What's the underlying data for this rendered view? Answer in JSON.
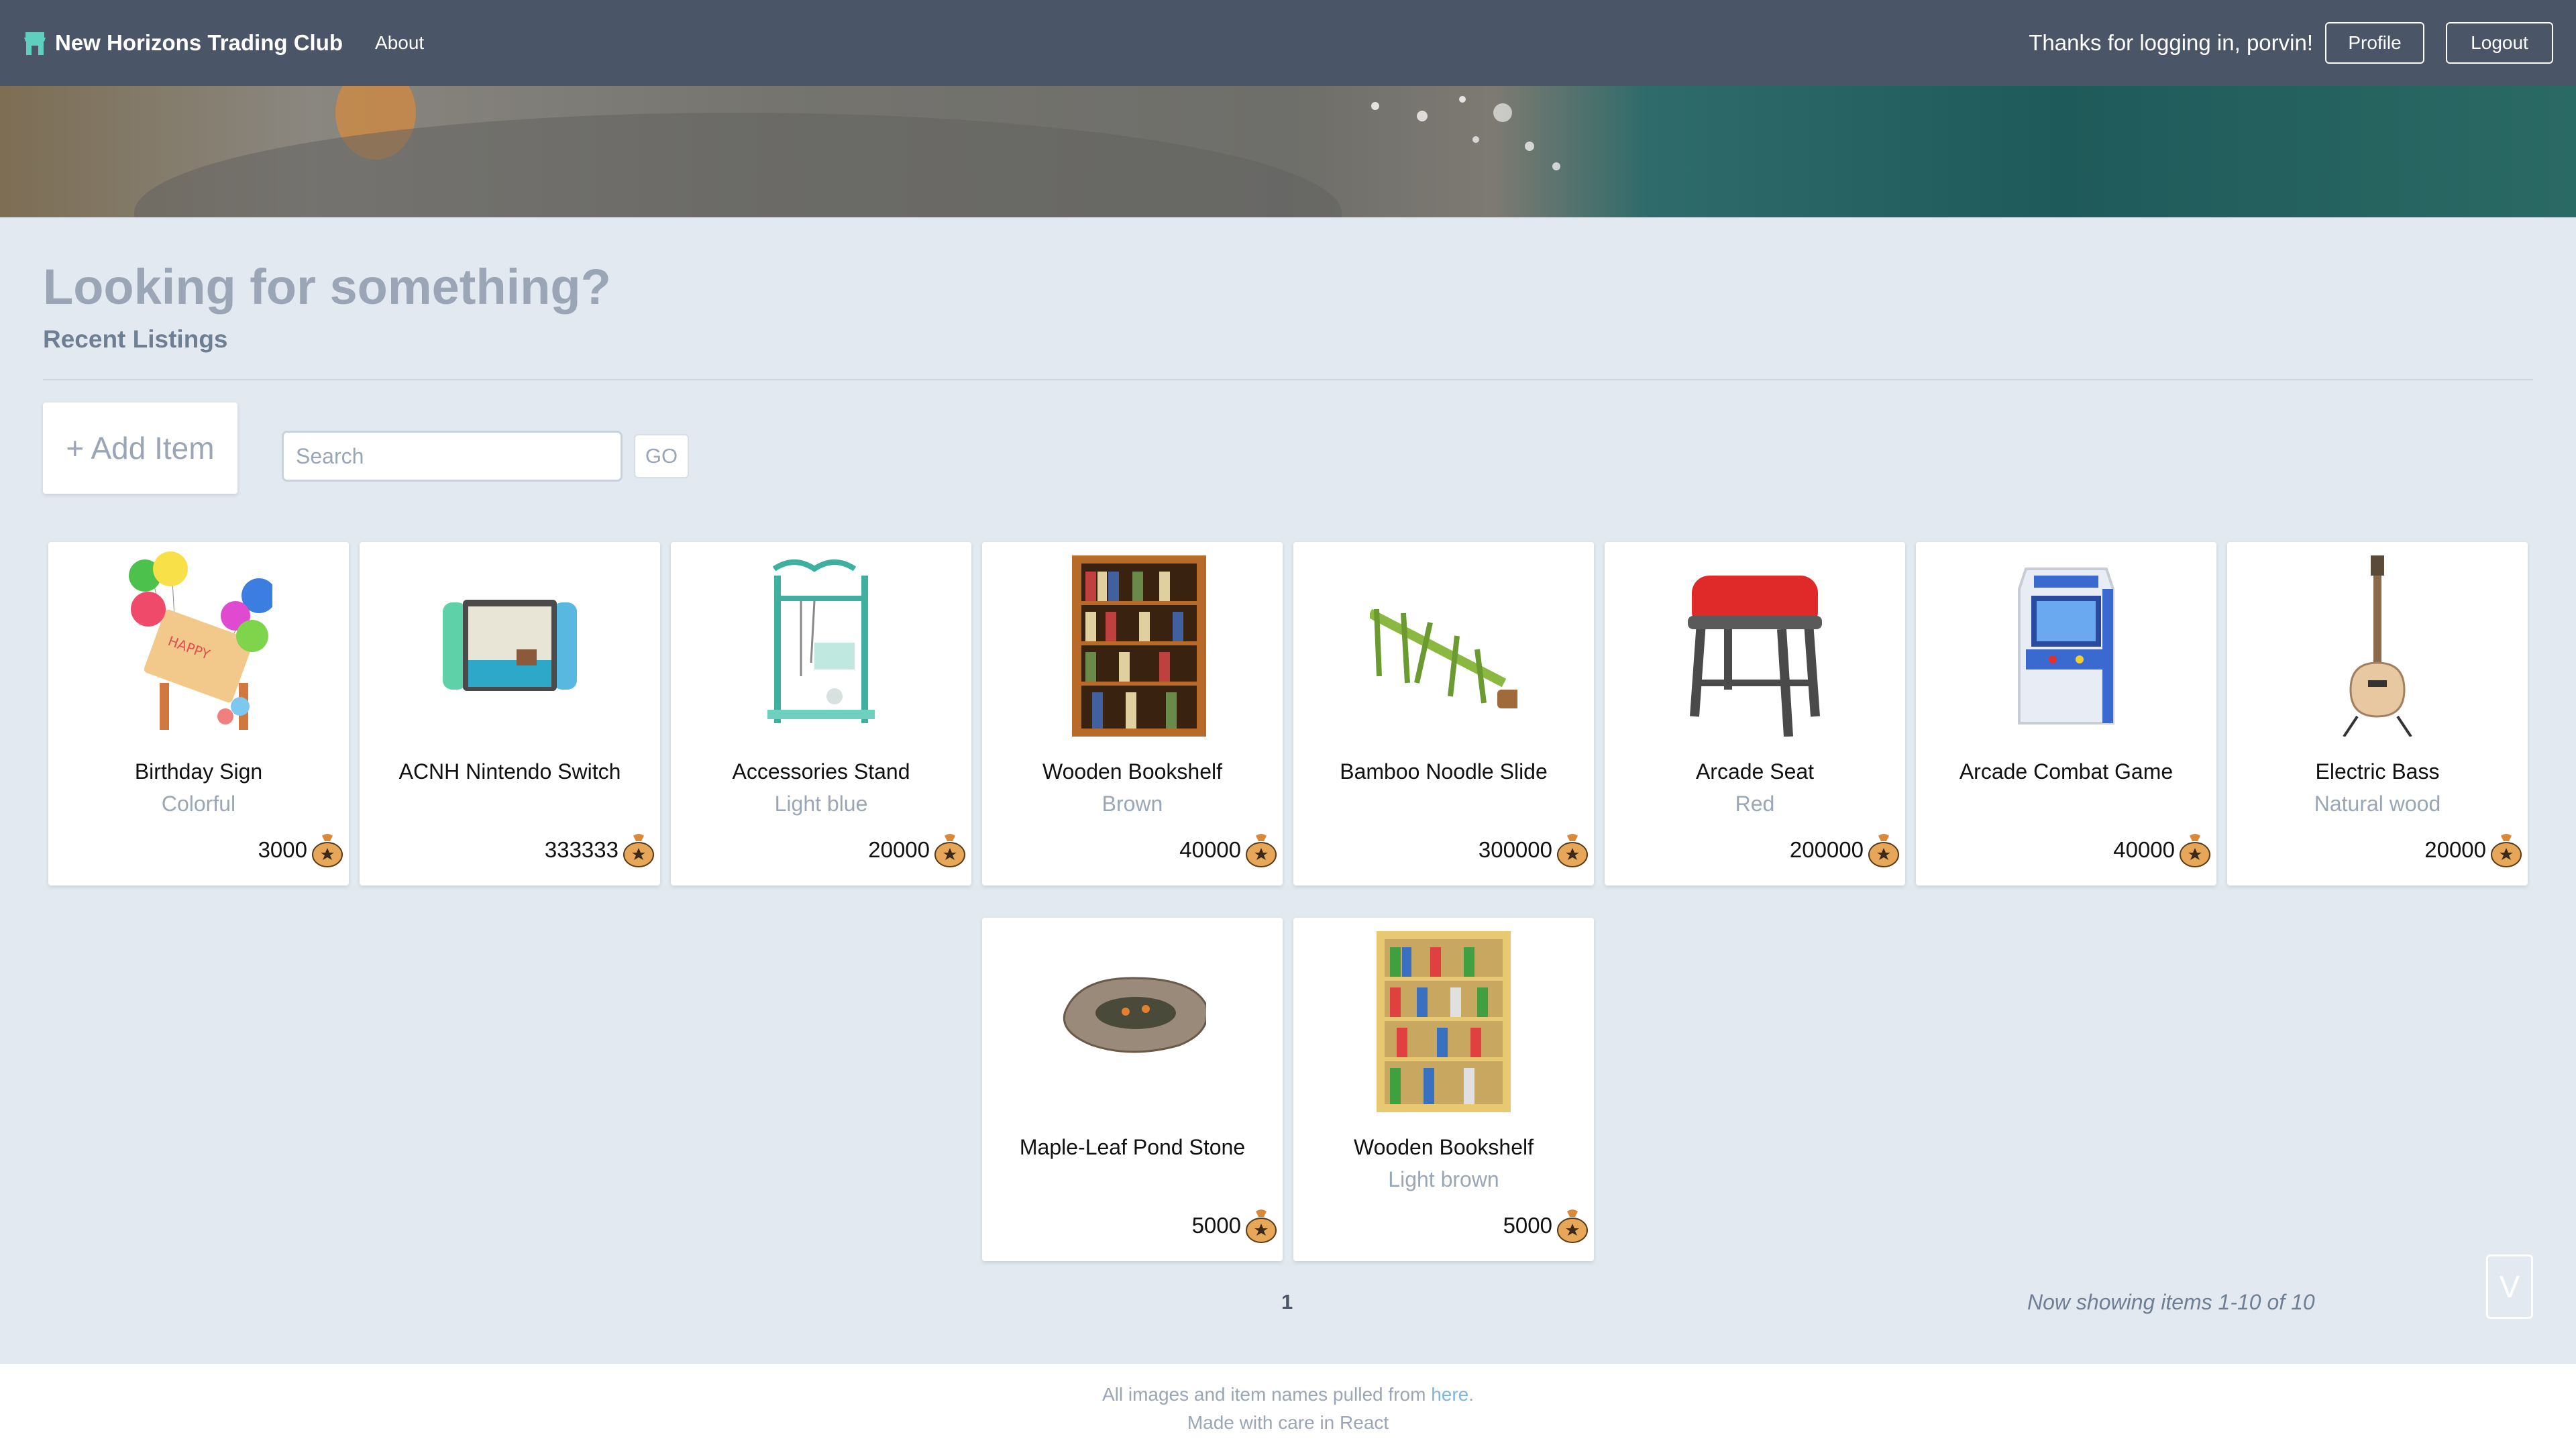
{
  "navbar": {
    "brand": "New Horizons Trading Club",
    "about": "About",
    "welcome": "Thanks for logging in, porvin!",
    "profile": "Profile",
    "logout": "Logout"
  },
  "main": {
    "title": "Looking for something?",
    "subtitle": "Recent Listings",
    "add_item": "+ Add Item",
    "search_placeholder": "Search",
    "go": "GO"
  },
  "items": [
    {
      "name": "Birthday Sign",
      "variant": "Colorful",
      "price": "3000"
    },
    {
      "name": "ACNH Nintendo Switch",
      "variant": "",
      "price": "333333"
    },
    {
      "name": "Accessories Stand",
      "variant": "Light blue",
      "price": "20000"
    },
    {
      "name": "Wooden Bookshelf",
      "variant": "Brown",
      "price": "40000"
    },
    {
      "name": "Bamboo Noodle Slide",
      "variant": "",
      "price": "300000"
    },
    {
      "name": "Arcade Seat",
      "variant": "Red",
      "price": "200000"
    },
    {
      "name": "Arcade Combat Game",
      "variant": "",
      "price": "40000"
    },
    {
      "name": "Electric Bass",
      "variant": "Natural wood",
      "price": "20000"
    },
    {
      "name": "Maple-Leaf Pond Stone",
      "variant": "",
      "price": "5000"
    },
    {
      "name": "Wooden Bookshelf",
      "variant": "Light brown",
      "price": "5000"
    }
  ],
  "pagination": {
    "current_page": "1",
    "showing": "Now showing items 1-10 of 10",
    "scroll_label": "V"
  },
  "footer": {
    "line1_prefix": "All images and item names pulled from ",
    "line1_link": "here",
    "line1_suffix": ".",
    "line2": "Made with care in React"
  },
  "colors": {
    "navbar": "#4b5568",
    "background": "#e3e9f1",
    "accent": "#5fd0c0",
    "muted": "#9aa6b6"
  }
}
